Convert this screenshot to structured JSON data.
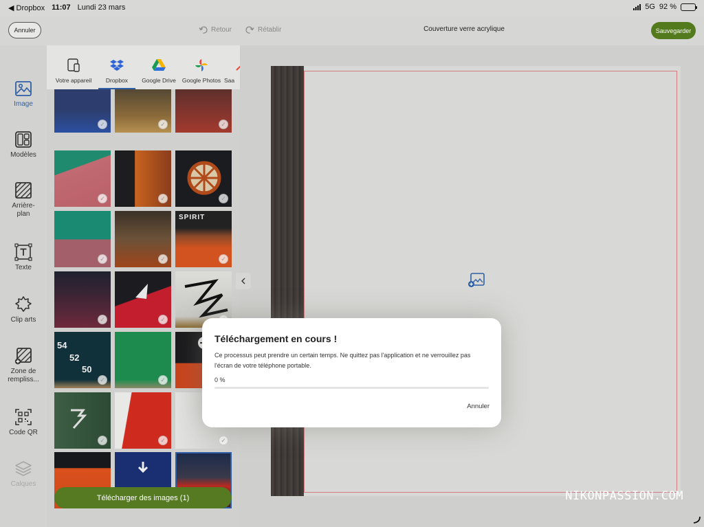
{
  "status_bar": {
    "back_app": "◀ Dropbox",
    "time": "11:07",
    "date": "Lundi 23 mars",
    "network": "5G",
    "battery": "92 %",
    "battery_level": 0.92
  },
  "toolbar": {
    "cancel_label": "Annuler",
    "undo_label": "Retour",
    "redo_label": "Rétablir",
    "document_title": "Couverture verre acrylique",
    "save_label": "Sauvegarder"
  },
  "tools": [
    {
      "label": "Image",
      "icon": "image-icon",
      "state": "active"
    },
    {
      "label": "Modèles",
      "icon": "templates-icon",
      "state": "normal"
    },
    {
      "label": "Arrière-plan",
      "icon": "background-icon",
      "state": "normal"
    },
    {
      "label": "Texte",
      "icon": "text-icon",
      "state": "normal"
    },
    {
      "label": "Clip arts",
      "icon": "clipart-icon",
      "state": "normal"
    },
    {
      "label": "Zone de rempliss...",
      "icon": "fill-zone-icon",
      "state": "normal"
    },
    {
      "label": "Code QR",
      "icon": "qr-code-icon",
      "state": "normal"
    },
    {
      "label": "Calques",
      "icon": "layers-icon",
      "state": "disabled"
    }
  ],
  "sources": [
    {
      "label": "Votre appareil",
      "icon": "device-icon"
    },
    {
      "label": "Dropbox",
      "icon": "dropbox-icon",
      "active": true
    },
    {
      "label": "Google Drive",
      "icon": "google-drive-icon"
    },
    {
      "label": "Google Photos",
      "icon": "google-photos-icon"
    },
    {
      "label": "Saa",
      "icon": "more-source-icon"
    }
  ],
  "thumbnails": {
    "selected_index": 20,
    "labels": {
      "spirit": "SPIRIT",
      "n54": "54",
      "n52": "52",
      "n50": "50"
    }
  },
  "upload_button": "Télécharger des images (1)",
  "canvas": {
    "placeholder": "add-image-icon"
  },
  "dialog": {
    "title": "Téléchargement en cours !",
    "body": "Ce processus peut prendre un certain temps. Ne quittez pas l'application et ne verrouillez pas l'écran de votre téléphone portable.",
    "percent_label": "0 %",
    "progress": 0,
    "cancel_label": "Annuler"
  },
  "watermark": "NIKONPASSION.COM",
  "colors": {
    "accent": "#2e5fa6",
    "primary_green": "#557a22",
    "bleed_line": "#d57a80"
  }
}
